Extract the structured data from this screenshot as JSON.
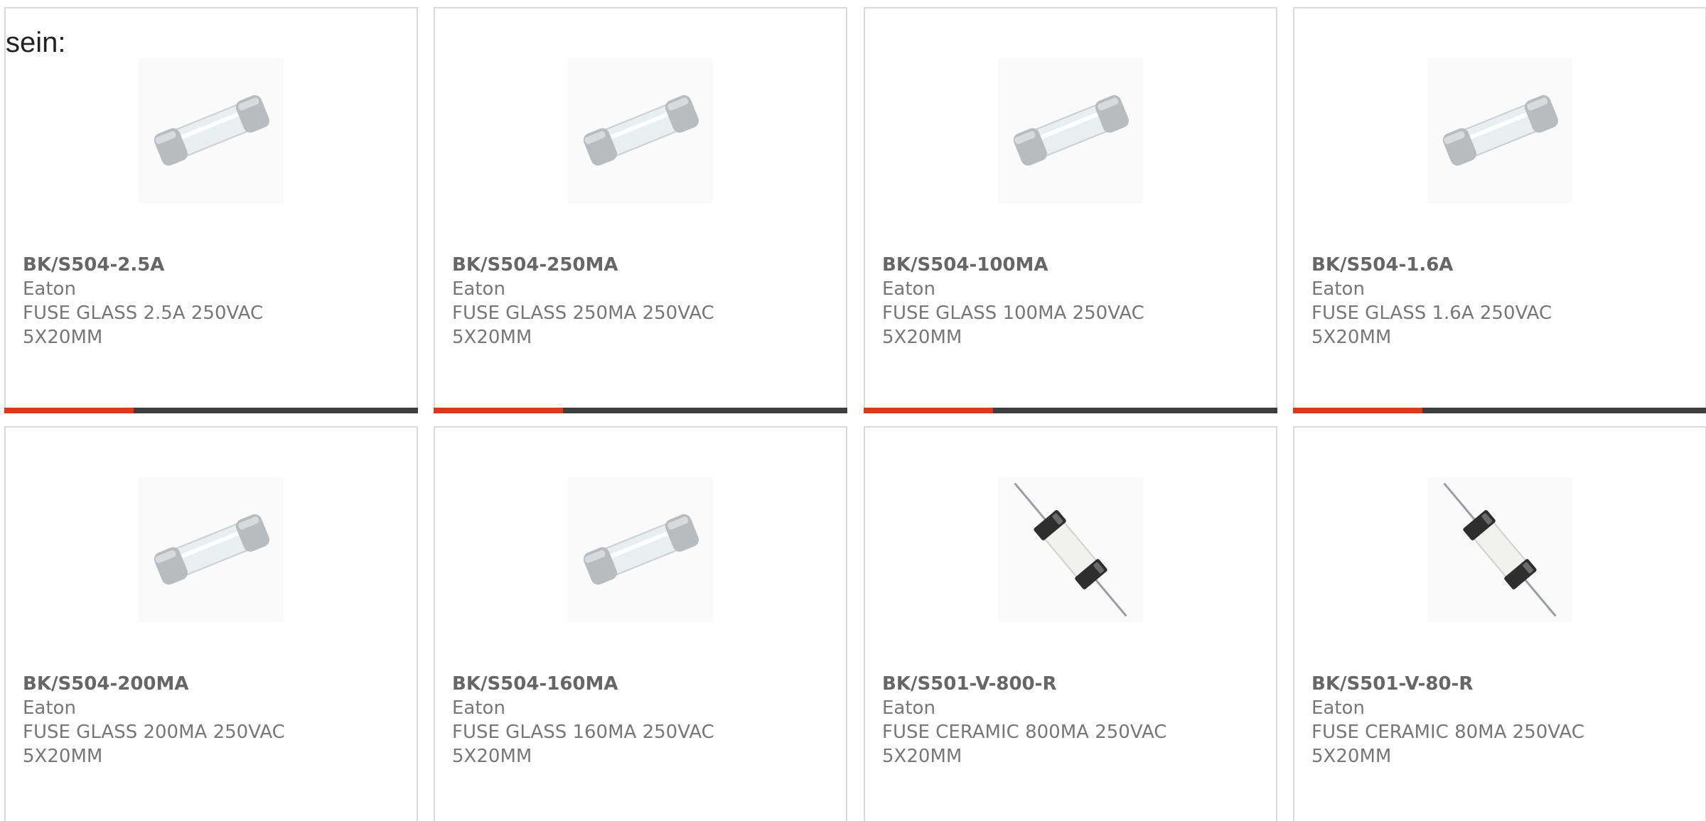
{
  "intro_text": "sein:",
  "accent_color": "#d83a1a",
  "cards": [
    {
      "part_number": "BK/S504-2.5A",
      "manufacturer": "Eaton",
      "desc_line1": "FUSE GLASS 2.5A 250VAC",
      "desc_line2": "5X20MM",
      "image": "glass-fuse-icon"
    },
    {
      "part_number": "BK/S504-250MA",
      "manufacturer": "Eaton",
      "desc_line1": "FUSE GLASS 250MA 250VAC",
      "desc_line2": "5X20MM",
      "image": "glass-fuse-icon"
    },
    {
      "part_number": "BK/S504-100MA",
      "manufacturer": "Eaton",
      "desc_line1": "FUSE GLASS 100MA 250VAC",
      "desc_line2": "5X20MM",
      "image": "glass-fuse-icon"
    },
    {
      "part_number": "BK/S504-1.6A",
      "manufacturer": "Eaton",
      "desc_line1": "FUSE GLASS 1.6A 250VAC",
      "desc_line2": "5X20MM",
      "image": "glass-fuse-icon"
    },
    {
      "part_number": "BK/S504-200MA",
      "manufacturer": "Eaton",
      "desc_line1": "FUSE GLASS 200MA 250VAC",
      "desc_line2": "5X20MM",
      "image": "glass-fuse-icon"
    },
    {
      "part_number": "BK/S504-160MA",
      "manufacturer": "Eaton",
      "desc_line1": "FUSE GLASS 160MA 250VAC",
      "desc_line2": "5X20MM",
      "image": "glass-fuse-icon"
    },
    {
      "part_number": "BK/S501-V-800-R",
      "manufacturer": "Eaton",
      "desc_line1": "FUSE CERAMIC 800MA 250VAC",
      "desc_line2": "5X20MM",
      "image": "ceramic-fuse-icon"
    },
    {
      "part_number": "BK/S501-V-80-R",
      "manufacturer": "Eaton",
      "desc_line1": "FUSE CERAMIC 80MA 250VAC",
      "desc_line2": "5X20MM",
      "image": "ceramic-fuse-icon"
    }
  ]
}
